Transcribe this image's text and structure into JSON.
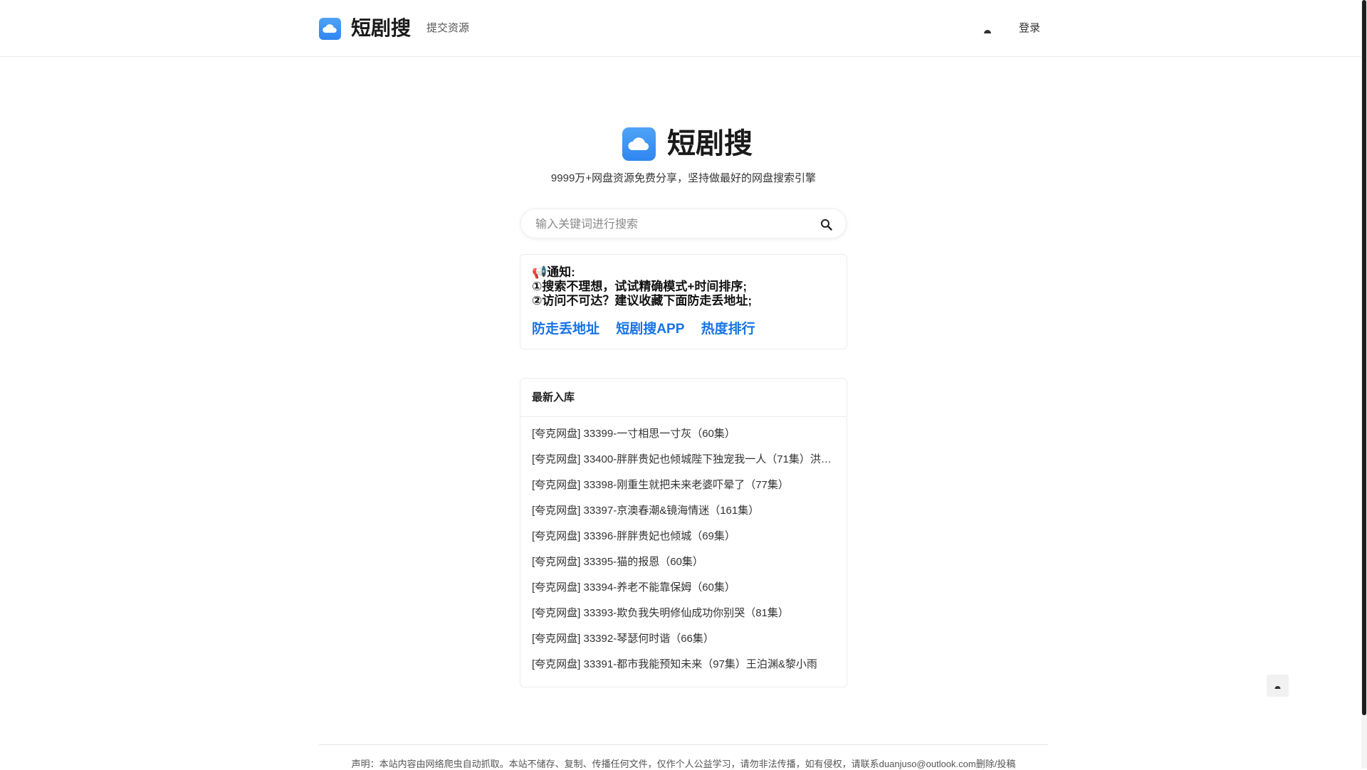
{
  "header": {
    "brand": "短剧搜",
    "nav_submit": "提交资源",
    "login": "登录"
  },
  "hero": {
    "title": "短剧搜",
    "subtitle": "9999万+网盘资源免费分享，坚持做最好的网盘搜索引擎"
  },
  "search": {
    "placeholder": "输入关键词进行搜索"
  },
  "notice": {
    "line1": "📢通知:",
    "line2": "①搜索不理想，试试精确模式+时间排序;",
    "line3": "②访问不可达？建议收藏下面防走丢地址;",
    "links": [
      "防走丢地址",
      "短剧搜APP",
      "热度排行"
    ]
  },
  "latest": {
    "title": "最新入库",
    "items": [
      "[夸克网盘] 33399-一寸相思一寸灰（60集）",
      "[夸克网盘] 33400-胖胖贵妃也倾城陛下独宠我一人（71集）洪乔…",
      "[夸克网盘] 33398-刚重生就把未来老婆吓晕了（77集）",
      "[夸克网盘] 33397-京澳春潮&镜海情迷（161集）",
      "[夸克网盘] 33396-胖胖贵妃也倾城（69集）",
      "[夸克网盘] 33395-猫的报恩（60集）",
      "[夸克网盘] 33394-养老不能靠保姆（60集）",
      "[夸克网盘] 33393-欺负我失明修仙成功你别哭（81集）",
      "[夸克网盘] 33392-琴瑟何时谐（66集）",
      "[夸克网盘] 33391-都市我能预知未来（97集）王泊渊&黎小雨"
    ]
  },
  "footer": {
    "text": "声明：本站内容由网络爬虫自动抓取。本站不储存、复制、传播任何文件，仅作个人公益学习，请勿非法传播，如有侵权，请联系duanjuso@outlook.com删除/投稿"
  },
  "colors": {
    "brand_blue": "#3d8ef5",
    "link_blue": "#1773e6"
  }
}
